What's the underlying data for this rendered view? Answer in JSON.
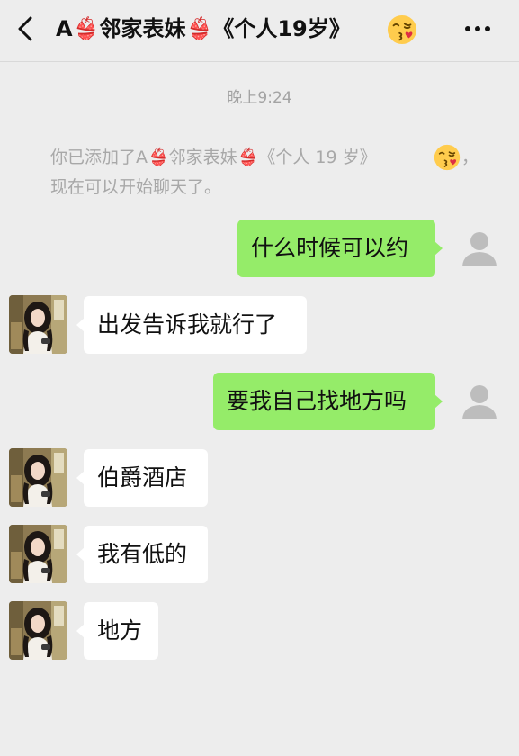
{
  "header": {
    "title": "A👙邻家表妹👙《个人19岁》",
    "back_icon": "chevron-left-icon",
    "more_icon": "more-dots-icon",
    "title_emoji": "face-blowing-kiss"
  },
  "chat": {
    "timestamp": "晚上9:24",
    "system_message": {
      "line1": "你已添加了A👙邻家表妹👙《个人 19 岁》",
      "line1_suffix": "，",
      "line2": "现在可以开始聊天了。"
    },
    "messages": [
      {
        "sender": "me",
        "text": "什么时候可以约"
      },
      {
        "sender": "contact",
        "text": "出发告诉我就行了"
      },
      {
        "sender": "me",
        "text": "要我自己找地方吗"
      },
      {
        "sender": "contact",
        "text": "伯爵酒店"
      },
      {
        "sender": "contact",
        "text": "我有低的"
      },
      {
        "sender": "contact",
        "text": "地方"
      }
    ]
  },
  "colors": {
    "background": "#ededed",
    "my_bubble": "#95ec69",
    "contact_bubble": "#ffffff",
    "system_text": "#a8a8a8"
  }
}
